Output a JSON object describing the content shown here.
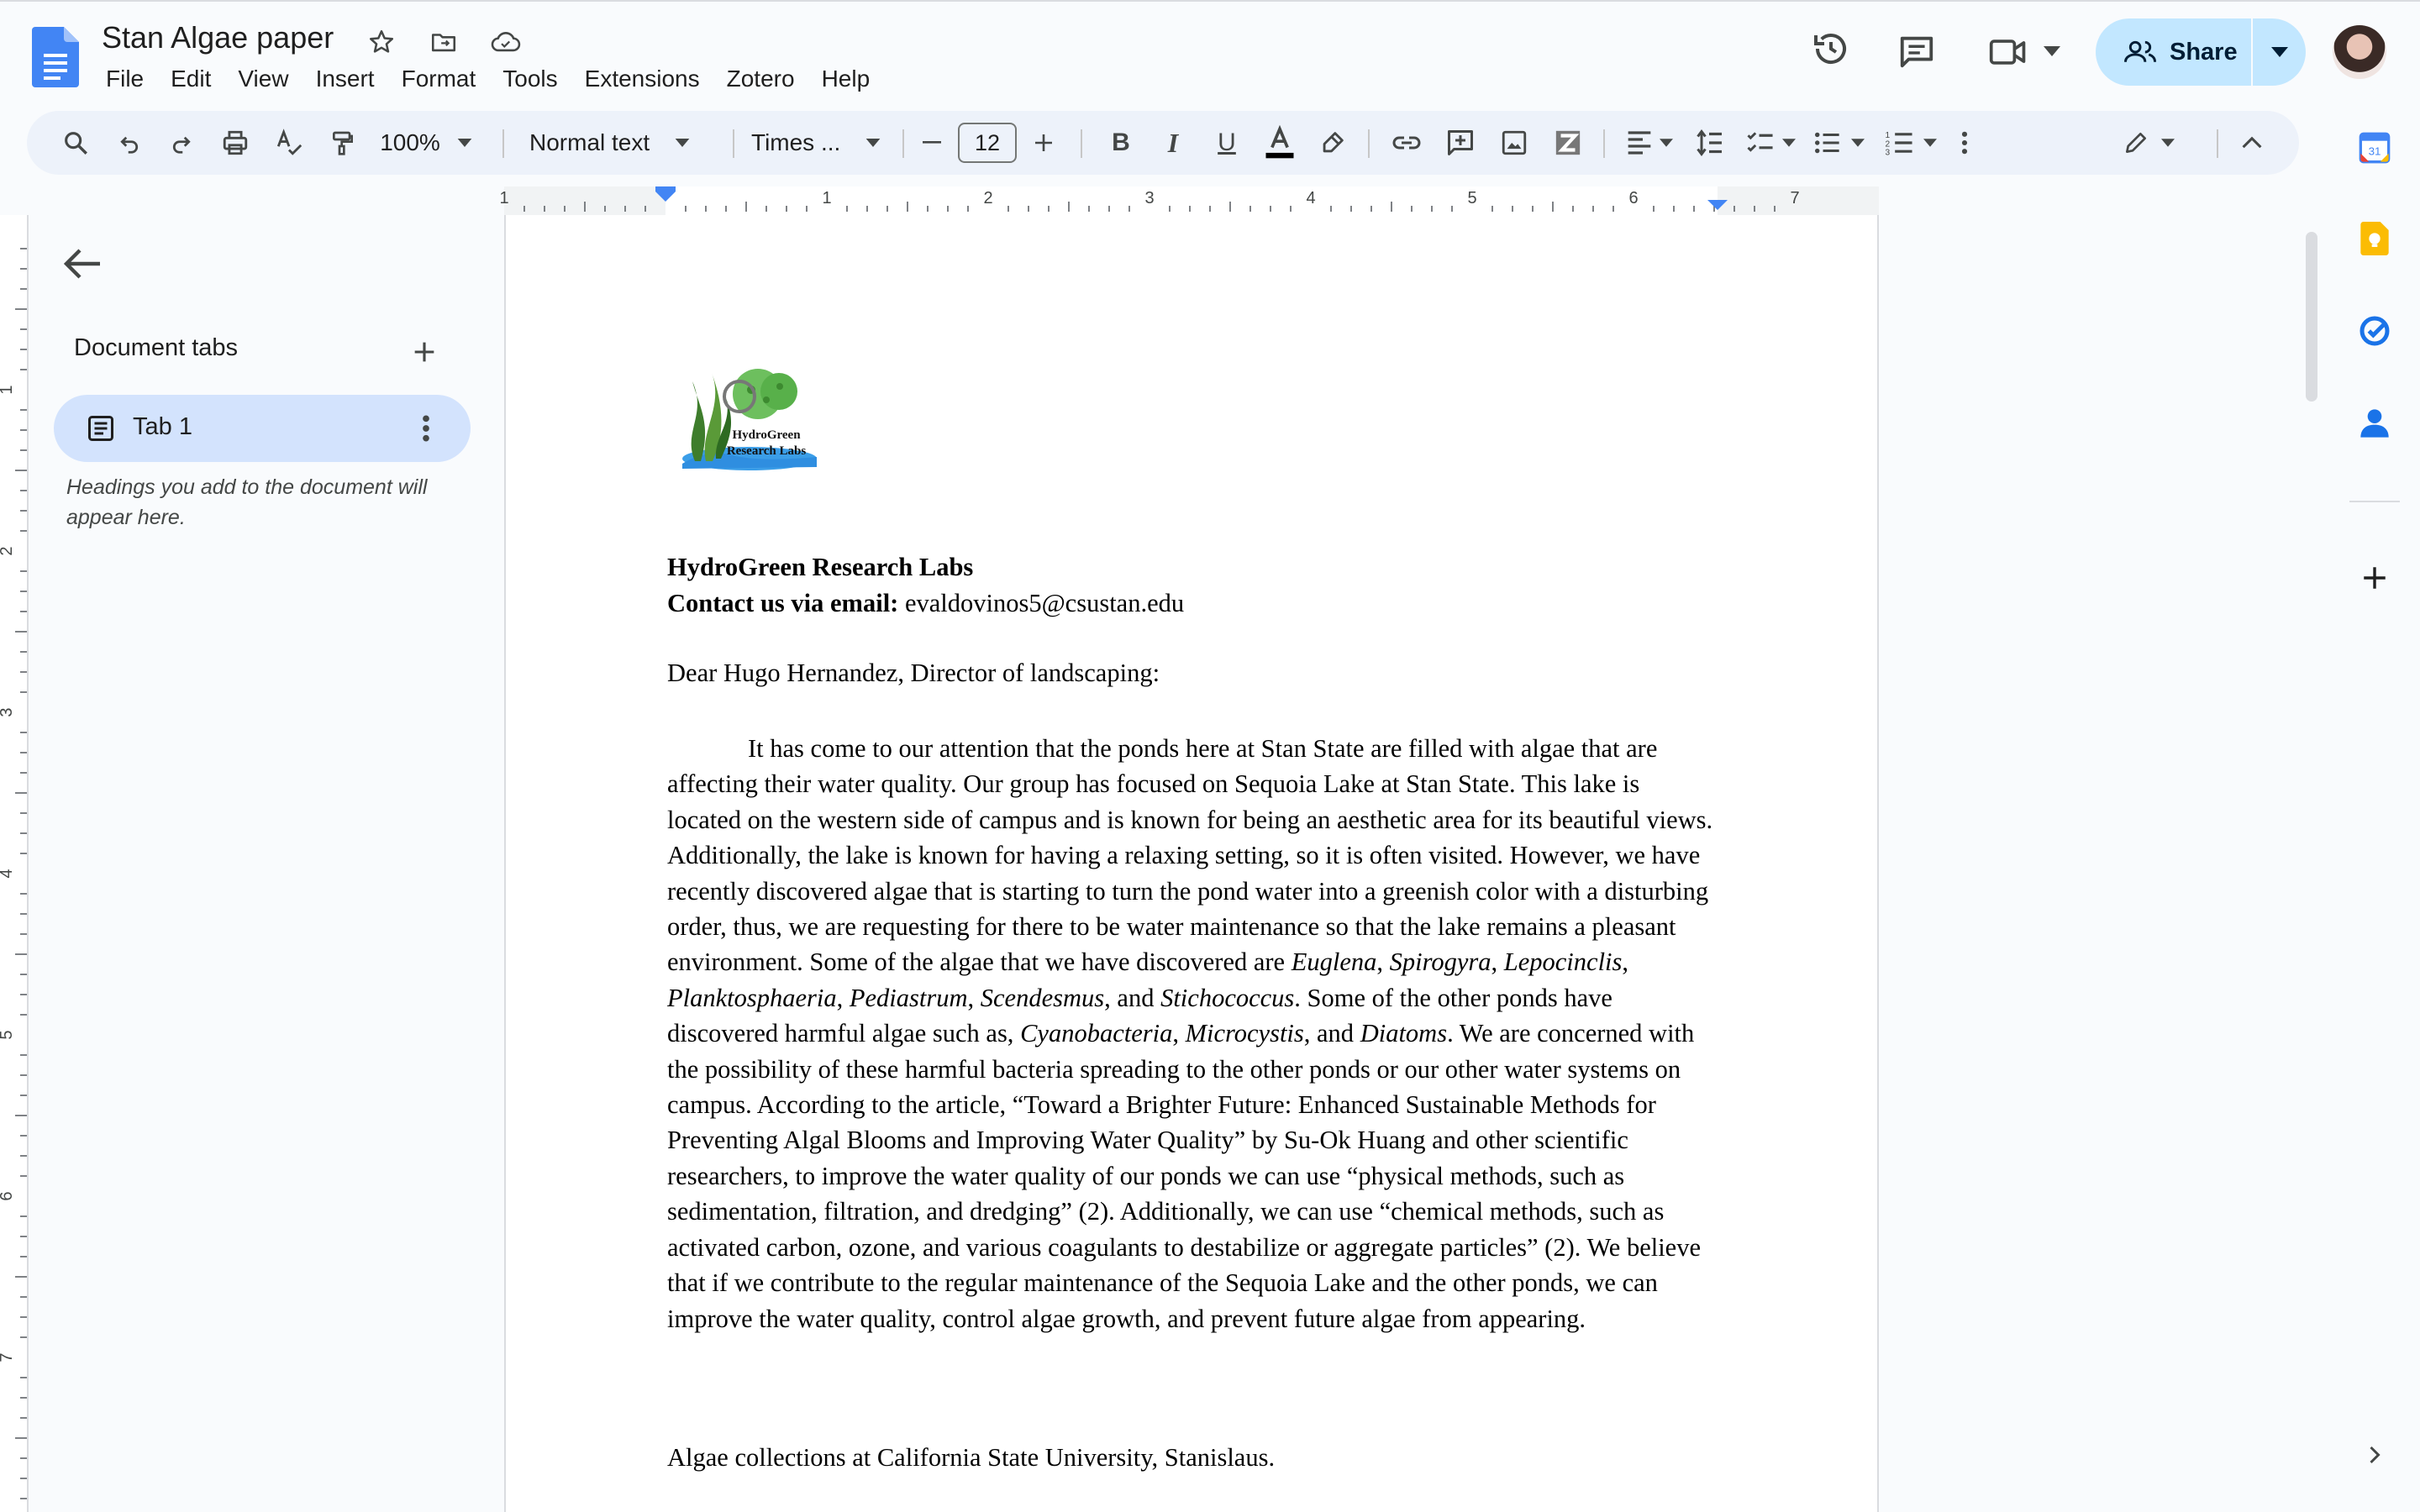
{
  "app": {
    "doc_title": "Stan Algae paper",
    "menu": [
      "File",
      "Edit",
      "View",
      "Insert",
      "Format",
      "Tools",
      "Extensions",
      "Zotero",
      "Help"
    ],
    "share_label": "Share"
  },
  "toolbar": {
    "zoom": "100%",
    "style": "Normal text",
    "font": "Times ...",
    "font_size": "12"
  },
  "ruler": {
    "labels": [
      "1",
      "1",
      "2",
      "3",
      "4",
      "5",
      "6",
      "7"
    ],
    "left_labels": [
      "1",
      "2",
      "3",
      "4",
      "5",
      "6",
      "7"
    ]
  },
  "sidebar": {
    "title": "Document tabs",
    "tab_label": "Tab 1",
    "hint": "Headings you add to the document will appear here."
  },
  "document": {
    "logo_text_1": "HydroGreen",
    "logo_text_2": "Research Labs",
    "org_name": "HydroGreen Research Labs",
    "contact_label": "Contact us via email:",
    "contact_email": " evaldovinos5@csustan.edu",
    "greeting": "Dear Hugo Hernandez, Director of landscaping:",
    "p1": "It has come to our attention that the ponds here at Stan State are filled with algae that are affecting their water quality. Our group has focused on Sequoia Lake at Stan State. This lake is located on the western side of campus and is known for being an aesthetic area for its beautiful views. Additionally, the lake is known for having a relaxing setting, so it is often visited. However, we have recently discovered algae that is starting to turn the pond water into a greenish color with a disturbing order, thus, we are requesting for there to be water maintenance so that the lake remains a pleasant environment. Some of the algae that we have discovered are ",
    "species_found": [
      "Euglena",
      "Spirogyra",
      "Lepocinclis",
      "Planktosphaeria",
      "Pediastrum",
      "Scendesmus",
      "Stichococcus"
    ],
    "p2": ". Some of the other ponds have discovered harmful algae such as, ",
    "harmful": [
      "Cyanobacteria",
      "Microcystis",
      "Diatoms"
    ],
    "p3": ". We are concerned with the possibility of these harmful bacteria spreading to the other ponds or our other water systems on campus. According to the article, “Toward a Brighter Future: Enhanced Sustainable Methods for Preventing Algal Blooms and Improving Water Quality” by Su-Ok Huang and other scientific researchers, to improve the water quality of our ponds we can use “physical methods, such as sedimentation, filtration, and dredging” (2). Additionally, we can use “chemical methods, such as activated carbon, ozone, and various coagulants to destabilize or aggregate particles” (2). We believe that if we contribute to the regular maintenance of the Sequoia Lake and the other ponds, we can improve the water quality, control algae growth, and prevent future algae from appearing.",
    "footer_line": "Algae collections at California State University, Stanislaus."
  },
  "colors": {
    "accent": "#0b57d0",
    "share_bg": "#c2e7ff",
    "tab_bg": "#d3e3fd",
    "toolbar_bg": "#edf2fa"
  }
}
